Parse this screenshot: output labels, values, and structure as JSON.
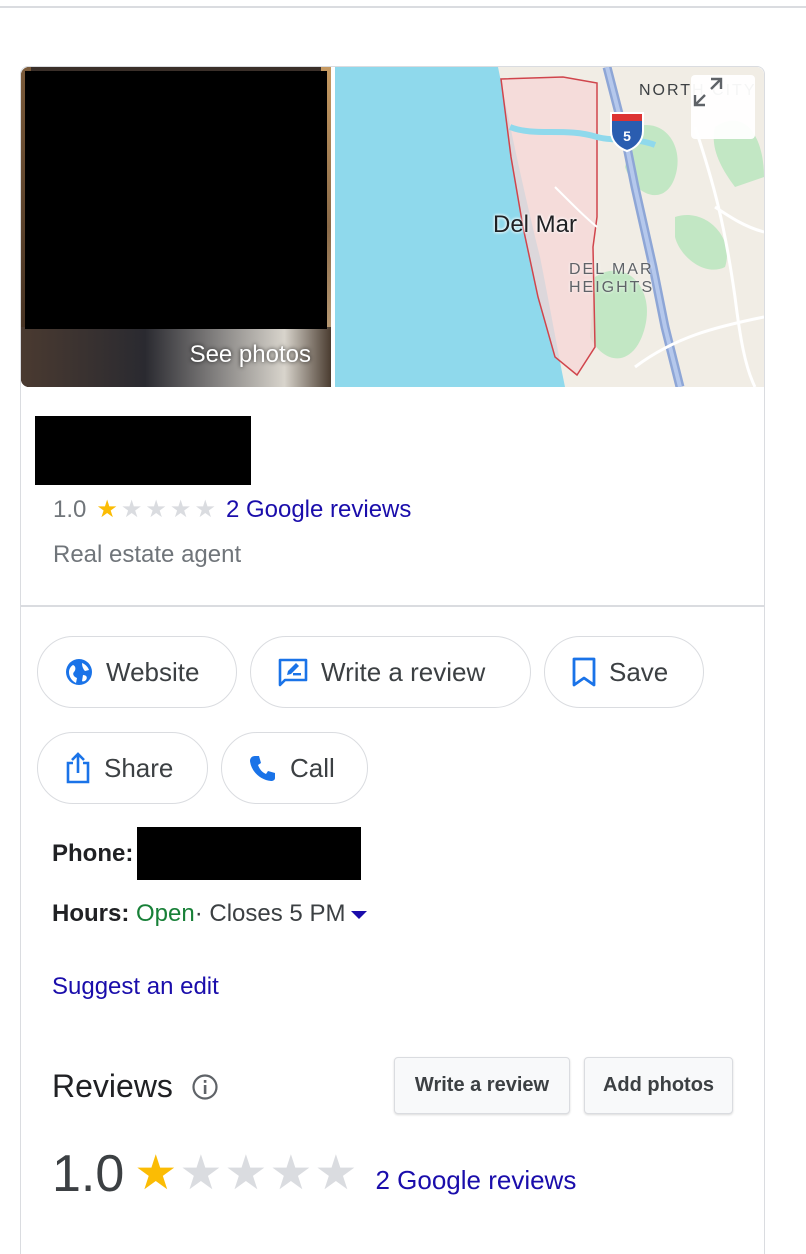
{
  "header": {
    "photo_label": "See photos"
  },
  "map": {
    "labels": {
      "place": "Del Mar",
      "heights_line1": "DEL MAR",
      "heights_line2": "HEIGHTS",
      "north": "NORTH CITY",
      "interstate": "5"
    },
    "colors": {
      "water": "#8fd9ec",
      "boundary": "#d0454c",
      "park": "#c2e7c4",
      "highway": "#8ea6d6"
    }
  },
  "business": {
    "rating": "1.0",
    "rating_value": 1,
    "rating_max": 5,
    "reviews_link": "2 Google reviews",
    "category": "Real estate agent"
  },
  "actions": {
    "website": "Website",
    "write_review": "Write a review",
    "save": "Save",
    "share": "Share",
    "call": "Call"
  },
  "details": {
    "phone_label": "Phone:",
    "hours_label": "Hours:",
    "hours_status": "Open",
    "hours_closes": " · Closes 5 PM"
  },
  "suggest_edit": "Suggest an edit",
  "reviews": {
    "title": "Reviews",
    "write_review_btn": "Write a review",
    "add_photos_btn": "Add photos",
    "rating": "1.0",
    "rating_value": 1,
    "count_link": "2 Google reviews"
  },
  "colors": {
    "link": "#1a0dab",
    "open": "#188038",
    "star_filled": "#fbbc04",
    "star_empty": "#dadce0",
    "icon_blue": "#1a73e8"
  }
}
